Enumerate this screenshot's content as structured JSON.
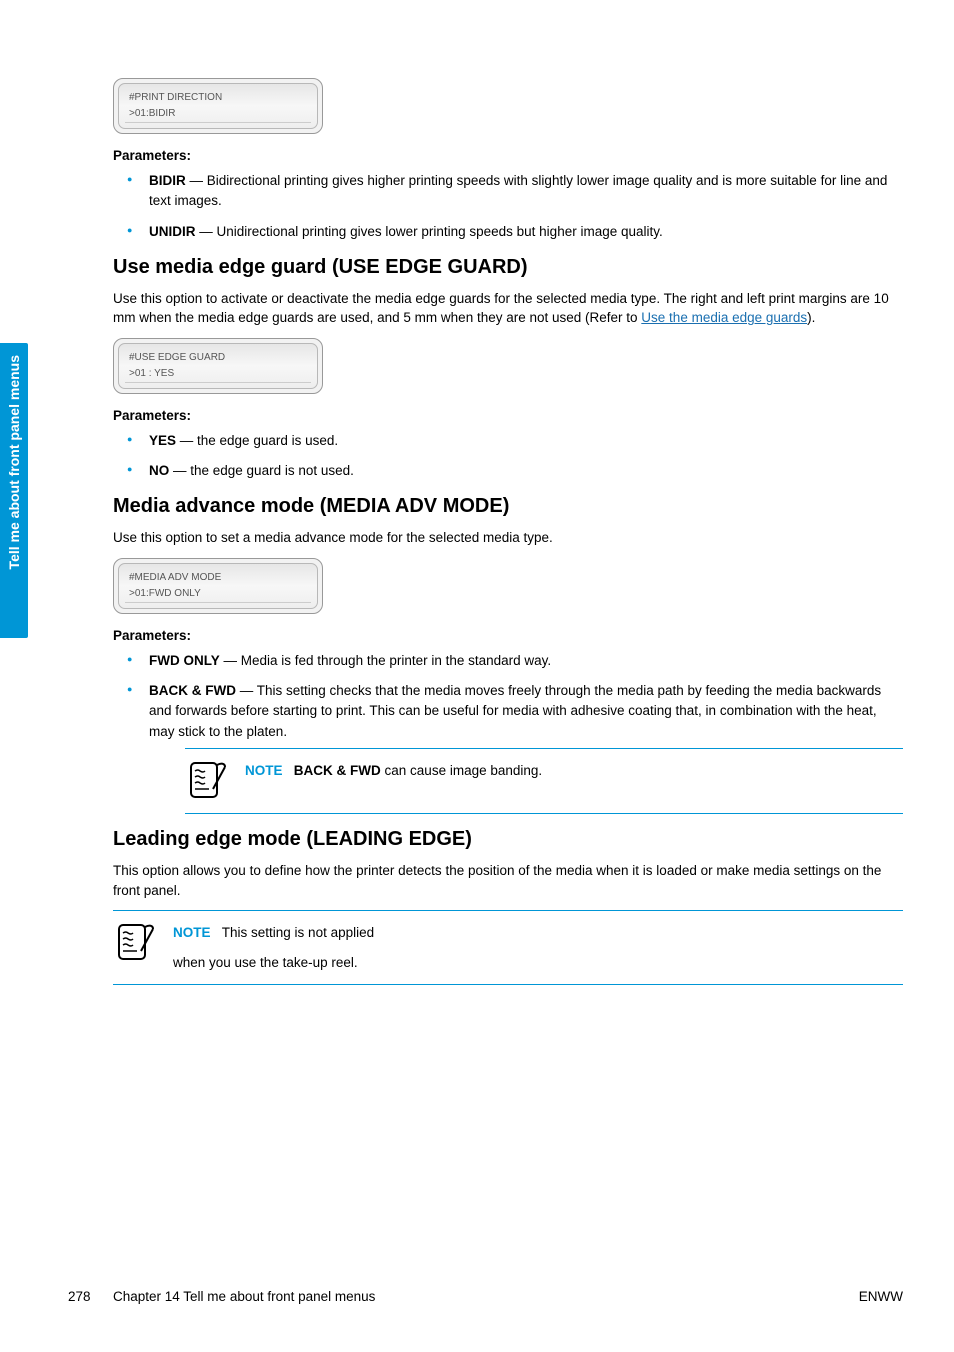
{
  "sideTab": "Tell me about front panel menus",
  "lcd1_line1": "#PRINT DIRECTION",
  "lcd1_line2": ">01:BIDIR",
  "parametersLabel": "Parameters:",
  "pd_item1_b": "BIDIR",
  "pd_item1_t": " — Bidirectional printing gives higher printing speeds with slightly lower image quality and is more suitable for line and text images.",
  "pd_item2_b": "UNIDIR",
  "pd_item2_t": " — Unidirectional printing gives lower printing speeds but higher image quality.",
  "h_edge": "Use media edge guard (USE EDGE GUARD)",
  "edge_para_pre": "Use this option to activate or deactivate the media edge guards for the selected media type. The right and left print margins are 10 mm when the media edge guards are used, and 5 mm when they are not used (Refer to ",
  "edge_para_link": "Use the media edge guards",
  "edge_para_post": ").",
  "lcd2_line1": "#USE EDGE GUARD",
  "lcd2_line2": ">01 : YES",
  "eg_item1_b": "YES",
  "eg_item1_t": " — the edge guard is used.",
  "eg_item2_b": "NO",
  "eg_item2_t": " — the edge guard is not used.",
  "h_adv": "Media advance mode (MEDIA ADV MODE)",
  "adv_para": "Use this option to set a media advance mode for the selected media type.",
  "lcd3_line1": "#MEDIA ADV MODE",
  "lcd3_line2": ">01:FWD ONLY",
  "adv_item1_b": "FWD ONLY",
  "adv_item1_t": " — Media is fed through the printer in the standard way.",
  "adv_item2_b": "BACK & FWD",
  "adv_item2_t": " — This setting checks that the media moves freely through the media path by feeding the media backwards and forwards before starting to print. This can be useful for media with adhesive coating that, in combination with the heat, may stick to the platen.",
  "noteLabel": "NOTE",
  "note1_b": "BACK & FWD",
  "note1_t": " can cause image banding.",
  "h_lead": "Leading edge mode (LEADING EDGE)",
  "lead_para": "This option allows you to define how the printer detects the position of the media when it is loaded or make media settings on the front panel.",
  "note2_line1": "This setting is not applied",
  "note2_line2": "when you use the take-up reel.",
  "pageNum": "278",
  "footerChap": "Chapter 14   Tell me about front panel menus",
  "footerRight": "ENWW"
}
